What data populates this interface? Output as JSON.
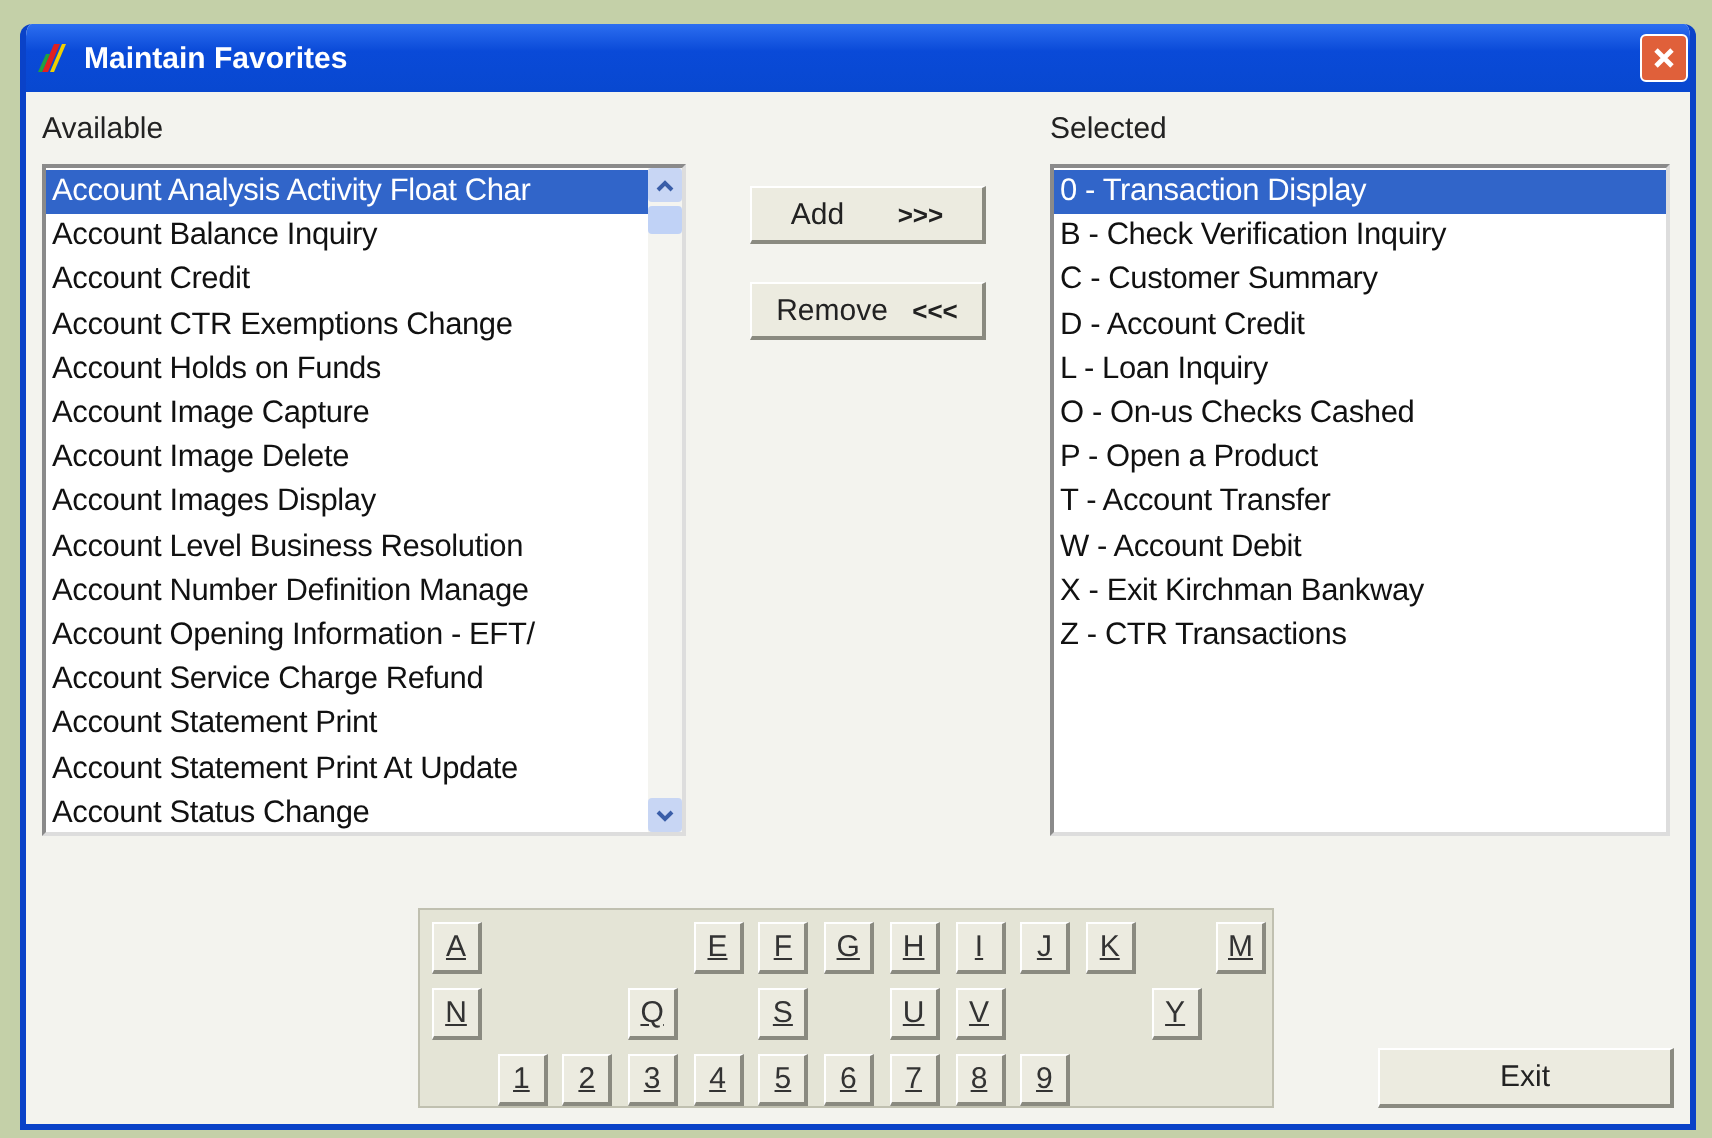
{
  "window": {
    "title": "Maintain Favorites"
  },
  "available": {
    "label": "Available",
    "items": [
      {
        "text": "Account Analysis Activity Float Char",
        "selected": true
      },
      {
        "text": "Account Balance Inquiry",
        "selected": false
      },
      {
        "text": "Account Credit",
        "selected": false
      },
      {
        "text": "Account CTR Exemptions Change",
        "selected": false
      },
      {
        "text": "Account Holds on Funds",
        "selected": false
      },
      {
        "text": "Account Image Capture",
        "selected": false
      },
      {
        "text": "Account Image Delete",
        "selected": false
      },
      {
        "text": "Account Images Display",
        "selected": false
      },
      {
        "text": "Account Level Business Resolution",
        "selected": false
      },
      {
        "text": "Account Number Definition Manage",
        "selected": false
      },
      {
        "text": "Account Opening Information - EFT/",
        "selected": false
      },
      {
        "text": "Account Service Charge Refund",
        "selected": false
      },
      {
        "text": "Account Statement Print",
        "selected": false
      },
      {
        "text": "Account Statement Print At Update",
        "selected": false
      },
      {
        "text": "Account Status Change",
        "selected": false
      }
    ]
  },
  "buttons": [
    {
      "label": "Add",
      "arrows": ">>>"
    },
    {
      "label": "Remove",
      "arrows": "<<<"
    }
  ],
  "selected": {
    "label": "Selected",
    "items": [
      {
        "text": "0 - Transaction Display",
        "selected": true
      },
      {
        "text": "B - Check Verification Inquiry",
        "selected": false
      },
      {
        "text": "C - Customer Summary",
        "selected": false
      },
      {
        "text": "D - Account Credit",
        "selected": false
      },
      {
        "text": "L - Loan Inquiry",
        "selected": false
      },
      {
        "text": "O - On-us Checks Cashed",
        "selected": false
      },
      {
        "text": "P - Open a Product",
        "selected": false
      },
      {
        "text": "T - Account Transfer",
        "selected": false
      },
      {
        "text": "W - Account Debit",
        "selected": false
      },
      {
        "text": "X - Exit  Kirchman Bankway",
        "selected": false
      },
      {
        "text": "Z - CTR Transactions",
        "selected": false
      }
    ]
  },
  "keypad": [
    [
      "A",
      "E",
      "F",
      "G",
      "H",
      "I",
      "J",
      "K",
      "M"
    ],
    [
      "N",
      "Q",
      "S",
      "U",
      "V",
      "Y"
    ],
    [
      "1",
      "2",
      "3",
      "4",
      "5",
      "6",
      "7",
      "8",
      "9"
    ]
  ],
  "exit_button": "Exit"
}
